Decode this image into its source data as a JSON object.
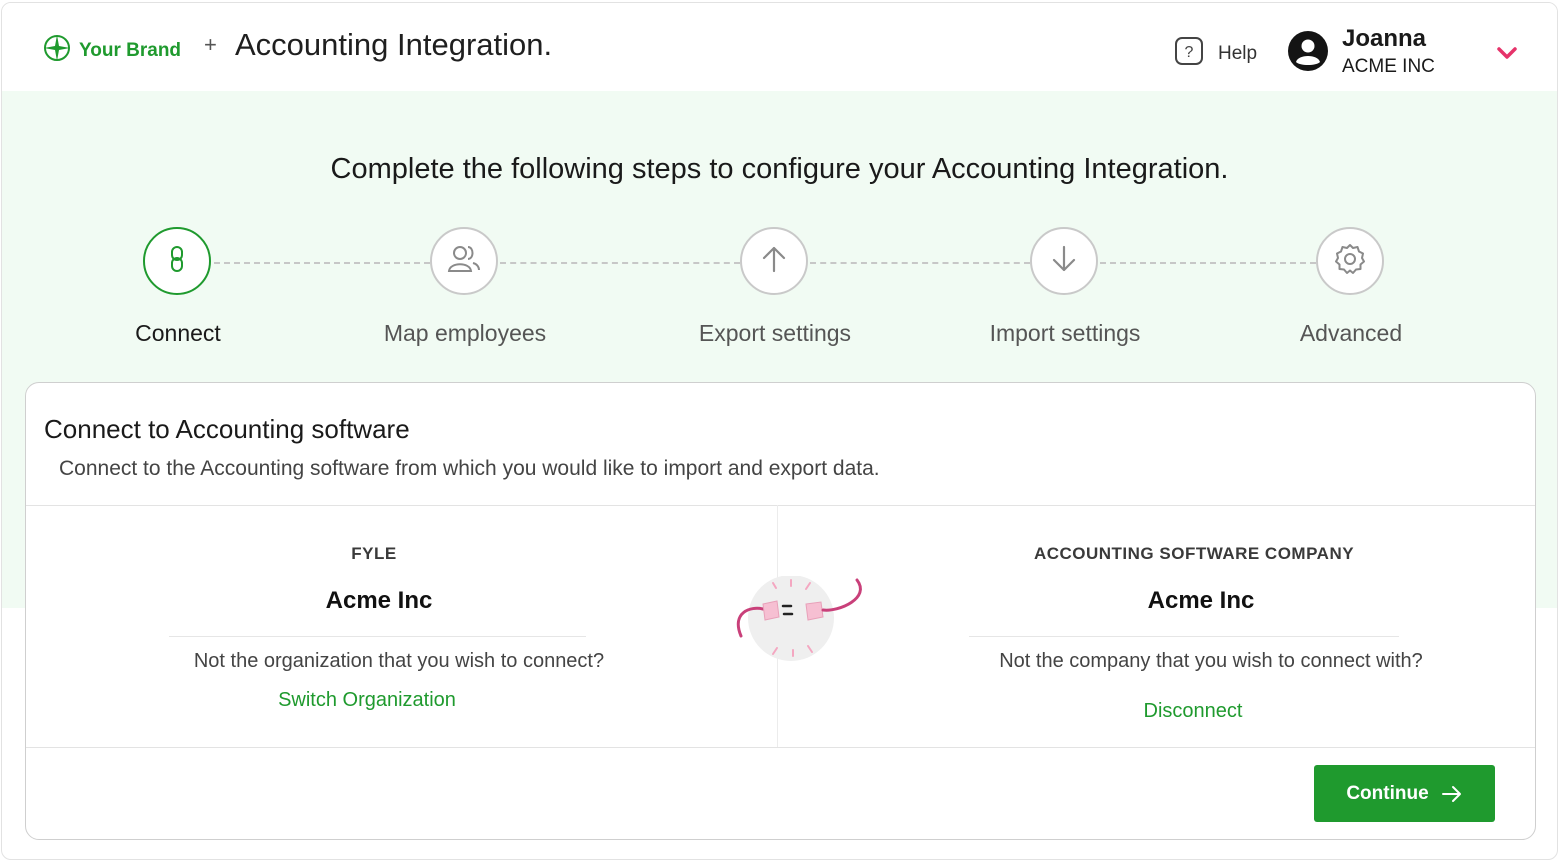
{
  "header": {
    "brand_name": "Your Brand",
    "plus": "+",
    "app_title": "Accounting Integration.",
    "help_label": "Help",
    "user_name": "Joanna",
    "user_org": "ACME INC"
  },
  "steps_heading": "Complete the following steps to configure your Accounting Integration.",
  "steps": [
    {
      "label": "Connect",
      "icon": "link-icon",
      "active": true
    },
    {
      "label": "Map employees",
      "icon": "users-icon",
      "active": false
    },
    {
      "label": "Export settings",
      "icon": "arrow-up-icon",
      "active": false
    },
    {
      "label": "Import settings",
      "icon": "arrow-down-icon",
      "active": false
    },
    {
      "label": "Advanced",
      "icon": "gear-icon",
      "active": false
    }
  ],
  "card": {
    "title": "Connect to Accounting software",
    "subtitle": "Connect to the Accounting software from which you would like to import and export data.",
    "left": {
      "label": "FYLE",
      "org_name": "Acme Inc",
      "question": "Not the organization that you wish to connect?",
      "action": "Switch Organization"
    },
    "right": {
      "label": "ACCOUNTING SOFTWARE COMPANY",
      "org_name": "Acme Inc",
      "question": "Not the company that you wish to connect with?",
      "action": "Disconnect"
    },
    "continue_label": "Continue"
  },
  "colors": {
    "accent": "#1f9a2e",
    "banner": "#f1fbf3",
    "chevron": "#e6336a",
    "plug": "#c9407a"
  }
}
